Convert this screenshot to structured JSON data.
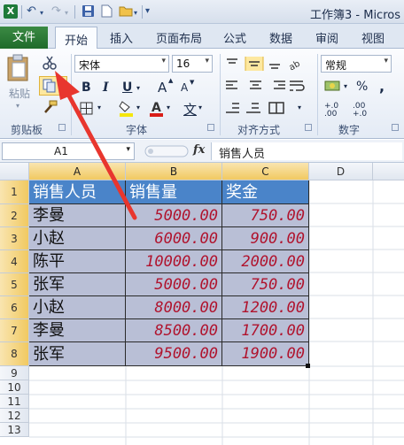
{
  "titlebar": {
    "app_icon": "X",
    "title": "工作簿3 - Micros"
  },
  "tabs": [
    "文件",
    "开始",
    "插入",
    "页面布局",
    "公式",
    "数据",
    "审阅",
    "视图"
  ],
  "ribbon": {
    "clipboard": {
      "paste_label": "粘贴",
      "group_label": "剪贴板"
    },
    "font": {
      "font_name": "宋体",
      "font_size": "16",
      "group_label": "字体",
      "bold": "B",
      "italic": "I",
      "underline": "U",
      "grow": "A",
      "shrink": "A",
      "wen": "文"
    },
    "alignment": {
      "group_label": "对齐方式"
    },
    "number": {
      "format": "常规",
      "percent": "%",
      "comma": ",",
      "group_label": "数字",
      "dec_up": "+.0 .00",
      "dec_down": ".00 +.0"
    }
  },
  "formula_bar": {
    "name_box": "A1",
    "fx": "fx",
    "content": "销售人员"
  },
  "sheet": {
    "columns": [
      "A",
      "B",
      "C",
      "D"
    ],
    "rows": [
      "1",
      "2",
      "3",
      "4",
      "5",
      "6",
      "7",
      "8",
      "9",
      "10",
      "11",
      "12",
      "13"
    ],
    "headers": [
      "销售人员",
      "销售量",
      "奖金"
    ],
    "data": [
      [
        "李曼",
        "5000.00",
        "750.00"
      ],
      [
        "小赵",
        "6000.00",
        "900.00"
      ],
      [
        "陈平",
        "10000.00",
        "2000.00"
      ],
      [
        "张军",
        "5000.00",
        "750.00"
      ],
      [
        "小赵",
        "8000.00",
        "1200.00"
      ],
      [
        "李曼",
        "8500.00",
        "1700.00"
      ],
      [
        "张军",
        "9500.00",
        "1900.00"
      ]
    ]
  },
  "colors": {
    "header_fill": "#4a84c9",
    "data_fill": "#b9bfd6",
    "number_text": "#b0132d",
    "arrow": "#e8362e",
    "file_tab": "#1f6b2a"
  }
}
